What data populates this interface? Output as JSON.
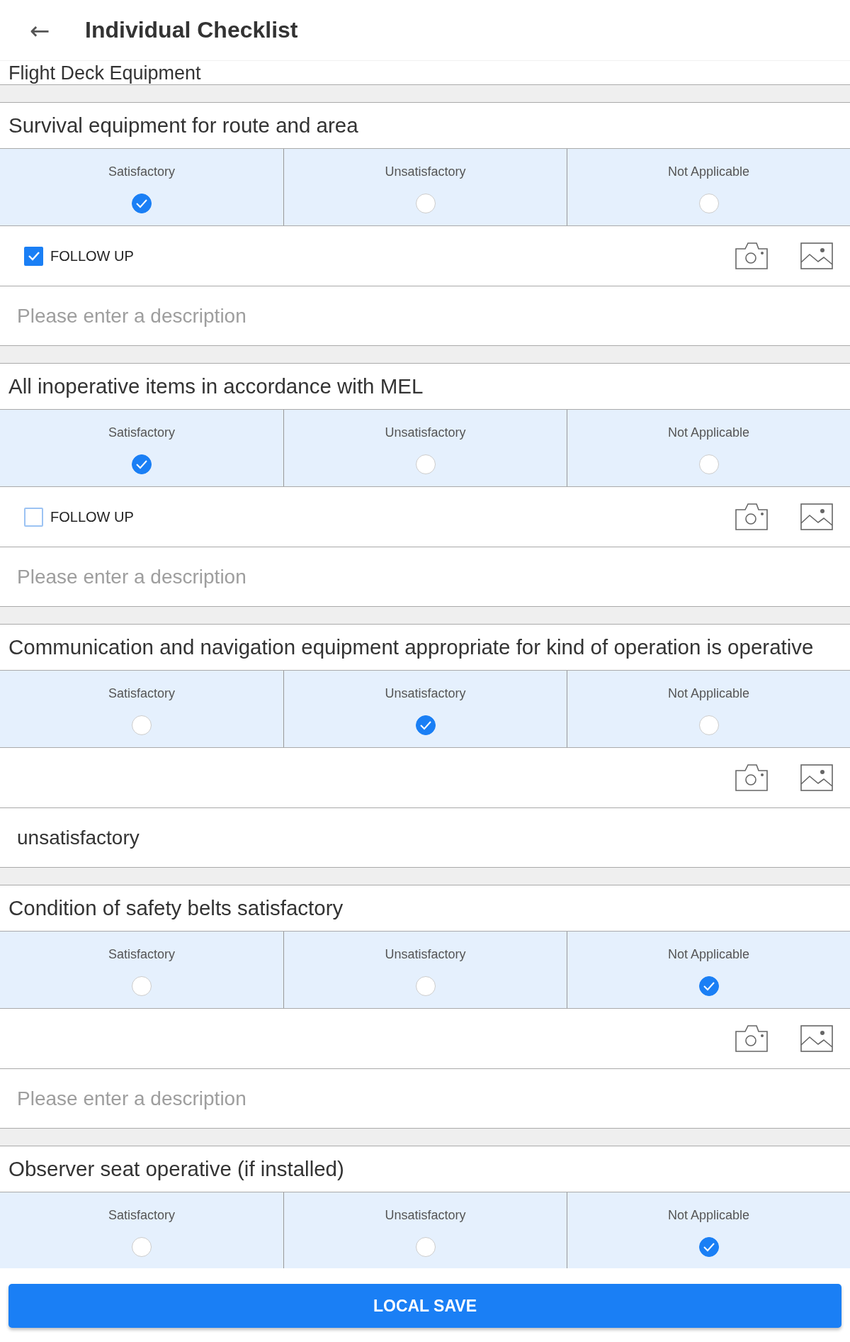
{
  "header": {
    "back": "←",
    "title": "Individual Checklist"
  },
  "section_title": "Flight Deck Equipment",
  "items": [
    {
      "title": "Survival equipment for route and area",
      "options": [
        {
          "label": "Satisfactory",
          "selected": true
        },
        {
          "label": "Unsatisfactory",
          "selected": false
        },
        {
          "label": "Not Applicable",
          "selected": false
        }
      ],
      "follow_up": {
        "label": "FOLLOW UP",
        "checked": true
      },
      "description": {
        "placeholder": "Please enter a description"
      }
    },
    {
      "title": "All inoperative items in accordance with MEL",
      "options": [
        {
          "label": "Satisfactory",
          "selected": true
        },
        {
          "label": "Unsatisfactory",
          "selected": false
        },
        {
          "label": "Not Applicable",
          "selected": false
        }
      ],
      "follow_up": {
        "label": "FOLLOW UP",
        "checked": false
      },
      "description": {
        "placeholder": "Please enter a description"
      }
    },
    {
      "title": "Communication and navigation equipment appropriate for kind of operation is operative",
      "options": [
        {
          "label": "Satisfactory",
          "selected": false
        },
        {
          "label": "Unsatisfactory",
          "selected": true
        },
        {
          "label": "Not Applicable",
          "selected": false
        }
      ],
      "description": {
        "value": "unsatisfactory"
      }
    },
    {
      "title": "Condition of safety belts satisfactory",
      "options": [
        {
          "label": "Satisfactory",
          "selected": false
        },
        {
          "label": "Unsatisfactory",
          "selected": false
        },
        {
          "label": "Not Applicable",
          "selected": true
        }
      ],
      "description": {
        "placeholder": "Please enter a description"
      }
    },
    {
      "title": "Observer seat operative (if installed)",
      "options": [
        {
          "label": "Satisfactory",
          "selected": false
        },
        {
          "label": "Unsatisfactory",
          "selected": false
        },
        {
          "label": "Not Applicable",
          "selected": true
        }
      ]
    }
  ],
  "save_button": "LOCAL SAVE"
}
